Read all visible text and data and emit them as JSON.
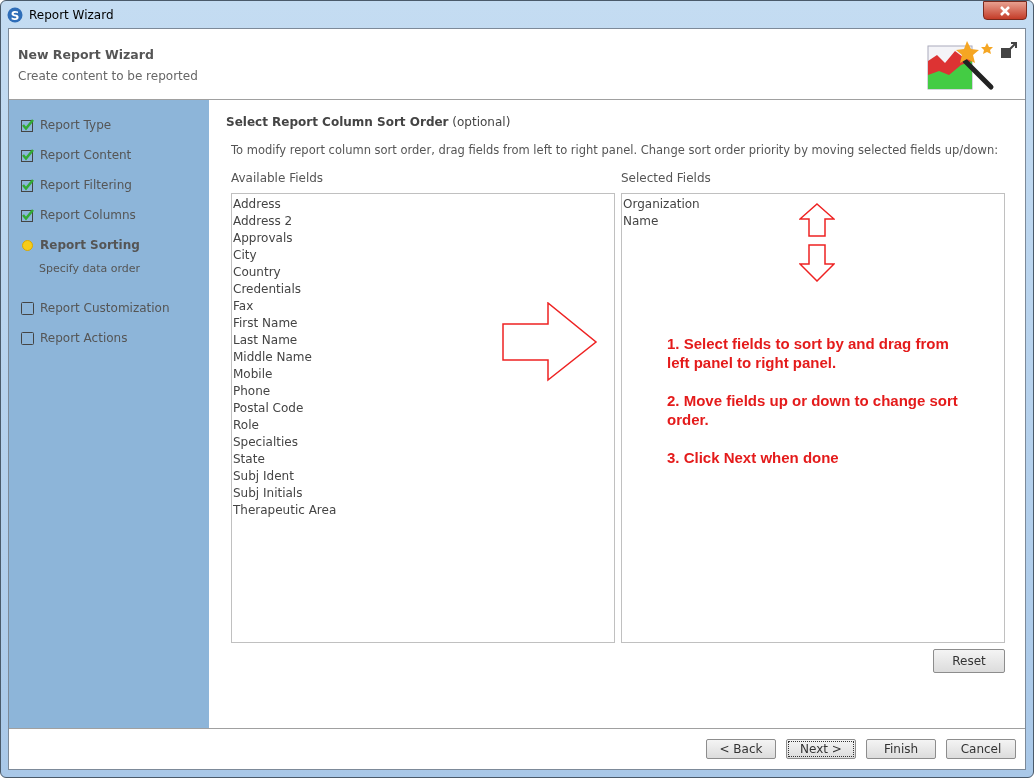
{
  "window": {
    "title": "Report Wizard",
    "logo_letter": "S"
  },
  "header": {
    "title": "New Report Wizard",
    "subtitle": "Create content to be reported"
  },
  "steps": [
    {
      "label": "Report Type",
      "kind": "done"
    },
    {
      "label": "Report Content",
      "kind": "done"
    },
    {
      "label": "Report Filtering",
      "kind": "done"
    },
    {
      "label": "Report Columns",
      "kind": "done"
    },
    {
      "label": "Report Sorting",
      "kind": "current",
      "detail": "Specify data order"
    },
    {
      "label": "Report Customization",
      "kind": "pending"
    },
    {
      "label": "Report Actions",
      "kind": "pending"
    }
  ],
  "page": {
    "title": "Select Report Column Sort Order",
    "title_note": "(optional)",
    "instructions": "To modify report column sort order, drag fields from left to right panel. Change sort order priority by moving selected fields up/down:"
  },
  "available": {
    "label": "Available Fields",
    "items": [
      "Address",
      "Address 2",
      "Approvals",
      "City",
      "Country",
      "Credentials",
      "Fax",
      "First Name",
      "Last Name",
      "Middle Name",
      "Mobile",
      "Phone",
      "Postal Code",
      "Role",
      "Specialties",
      "State",
      "Subj Ident",
      "Subj Initials",
      "Therapeutic Area"
    ]
  },
  "selected": {
    "label": "Selected Fields",
    "items": [
      "Organization",
      "Name"
    ]
  },
  "annotations": [
    "1. Select fields to sort by and drag from left panel to right panel.",
    "2. Move fields up or down to change sort order.",
    "3. Click Next when done"
  ],
  "reset_button": "Reset",
  "buttons": [
    {
      "label": "< Back",
      "focused": false
    },
    {
      "label": "Next >",
      "focused": true
    },
    {
      "label": "Finish",
      "focused": false
    },
    {
      "label": "Cancel",
      "focused": false
    }
  ]
}
